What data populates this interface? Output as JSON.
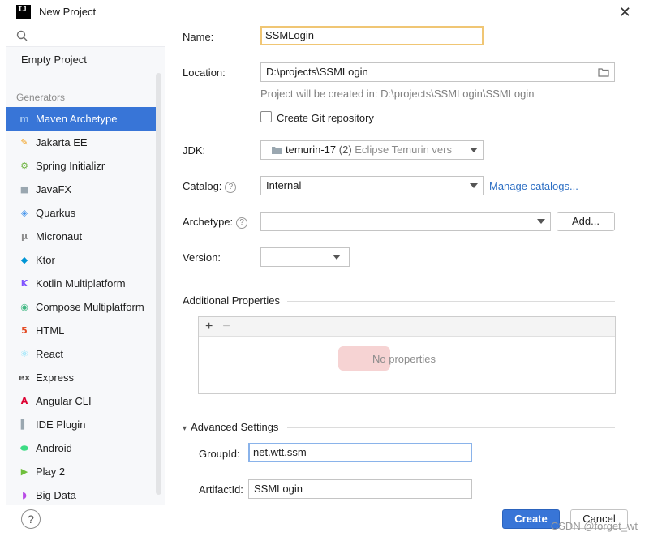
{
  "window": {
    "title": "New Project",
    "logo_text": "IJ"
  },
  "sidebar": {
    "empty_project": "Empty Project",
    "section": "Generators",
    "items": [
      {
        "label": "Maven Archetype",
        "icon": "maven-icon",
        "glyph": "m",
        "color": "#9bc0f0",
        "selected": true
      },
      {
        "label": "Jakarta EE",
        "icon": "jakarta-icon",
        "glyph": "✎",
        "color": "#f39c12"
      },
      {
        "label": "Spring Initializr",
        "icon": "spring-icon",
        "glyph": "⚙",
        "color": "#6db33f"
      },
      {
        "label": "JavaFX",
        "icon": "folder-icon",
        "glyph": "■",
        "color": "#9aa7b0"
      },
      {
        "label": "Quarkus",
        "icon": "quarkus-icon",
        "glyph": "◈",
        "color": "#4695eb"
      },
      {
        "label": "Micronaut",
        "icon": "micronaut-icon",
        "glyph": "μ",
        "color": "#8c8c8c"
      },
      {
        "label": "Ktor",
        "icon": "ktor-icon",
        "glyph": "◆",
        "color": "#0095d5"
      },
      {
        "label": "Kotlin Multiplatform",
        "icon": "kotlin-icon",
        "glyph": "K",
        "color": "#7f52ff"
      },
      {
        "label": "Compose Multiplatform",
        "icon": "compose-icon",
        "glyph": "◉",
        "color": "#41b883"
      },
      {
        "label": "HTML",
        "icon": "html5-icon",
        "glyph": "5",
        "color": "#e44d26"
      },
      {
        "label": "React",
        "icon": "react-icon",
        "glyph": "⚛",
        "color": "#61dafb"
      },
      {
        "label": "Express",
        "icon": "express-icon",
        "glyph": "ex",
        "color": "#555555"
      },
      {
        "label": "Angular CLI",
        "icon": "angular-icon",
        "glyph": "A",
        "color": "#dd0031"
      },
      {
        "label": "IDE Plugin",
        "icon": "plugin-icon",
        "glyph": "▌",
        "color": "#9aa7b0"
      },
      {
        "label": "Android",
        "icon": "android-icon",
        "glyph": "⬬",
        "color": "#3ddc84"
      },
      {
        "label": "Play 2",
        "icon": "play-icon",
        "glyph": "▶",
        "color": "#6fbf3c"
      },
      {
        "label": "Big Data",
        "icon": "bigdata-icon",
        "glyph": "◗",
        "color": "#b84ae6"
      }
    ]
  },
  "form": {
    "name_label": "Name:",
    "name_value": "SSMLogin",
    "location_label": "Location:",
    "location_value": "D:\\projects\\SSMLogin",
    "location_hint": "Project will be created in: D:\\projects\\SSMLogin\\SSMLogin",
    "git_label": "Create Git repository",
    "jdk_label": "JDK:",
    "jdk_value": "temurin-17",
    "jdk_version": "(2)",
    "jdk_vendor": "Eclipse Temurin version",
    "catalog_label": "Catalog:",
    "catalog_value": "Internal",
    "manage_catalogs": "Manage catalogs...",
    "archetype_label": "Archetype:",
    "archetype_value": "",
    "add_button": "Add...",
    "version_label": "Version:",
    "version_value": "",
    "additional_properties": "Additional Properties",
    "add_tool": "+",
    "remove_tool": "−",
    "no_properties": "No properties",
    "advanced_settings": "Advanced Settings",
    "groupid_label": "GroupId:",
    "groupid_value": "net.wtt.ssm",
    "artifactid_label": "ArtifactId:",
    "artifactid_value": "SSMLogin"
  },
  "footer": {
    "help": "?",
    "create": "Create",
    "cancel": "Cancel",
    "watermark": "CSDN @forget_wt"
  },
  "colors": {
    "accent": "#3875d7",
    "focus": "#f0c674",
    "link": "#2d6fc4"
  }
}
